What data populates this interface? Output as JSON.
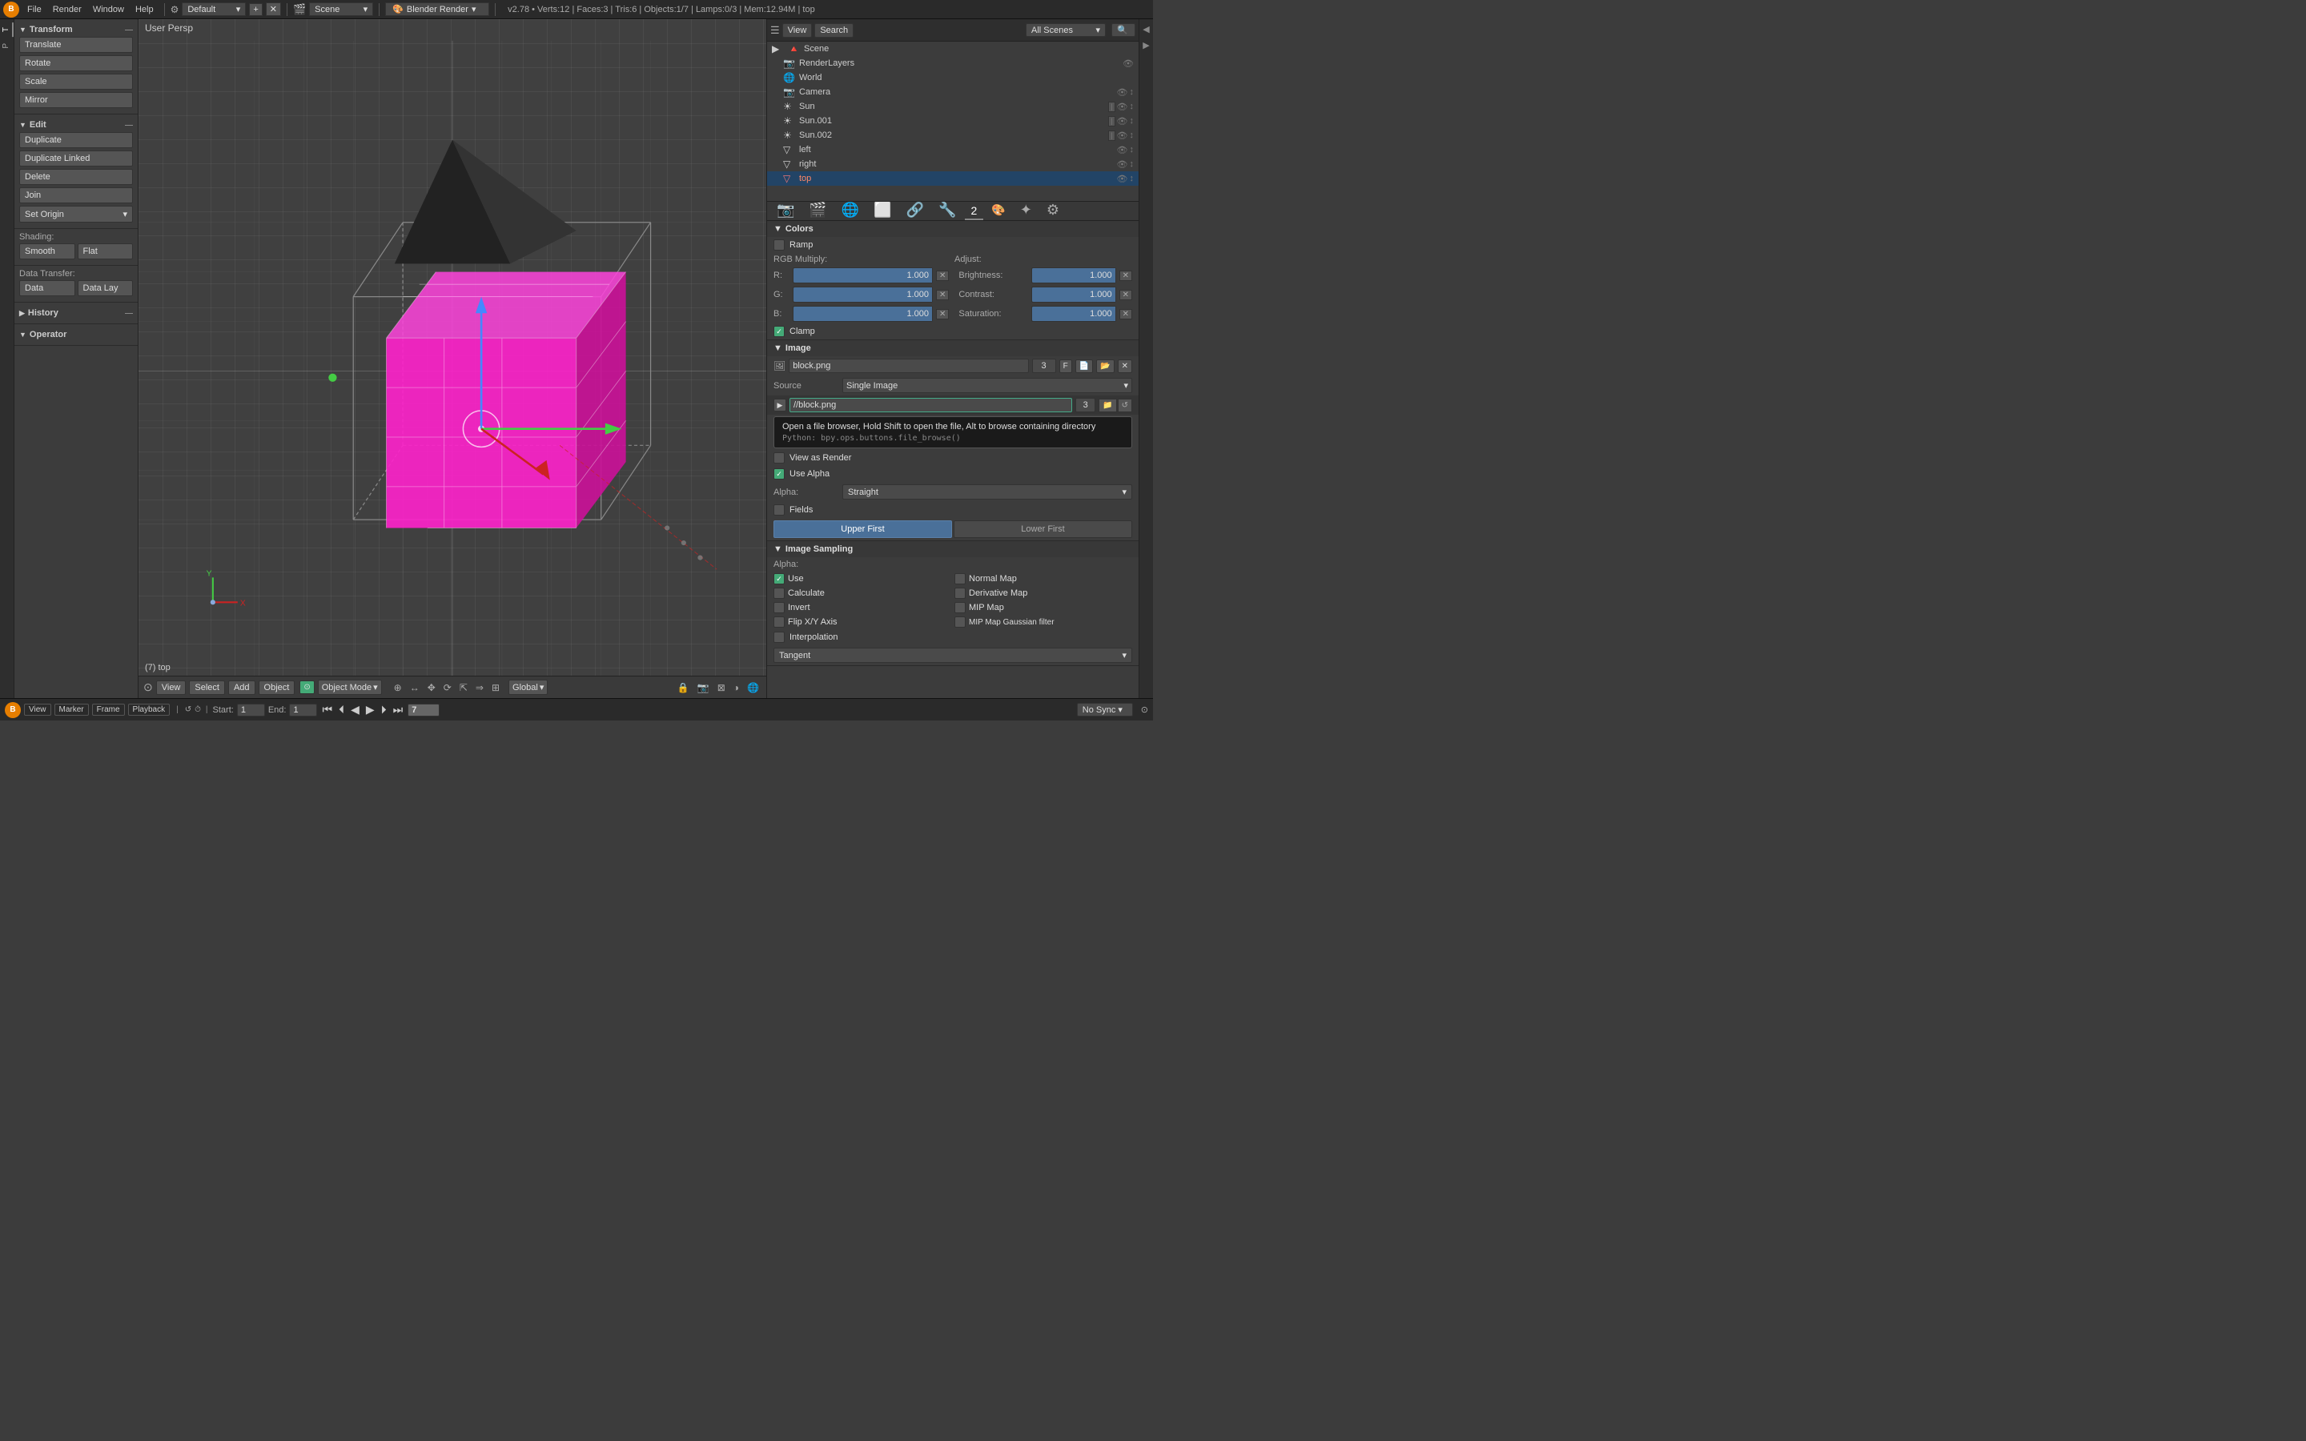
{
  "topbar": {
    "logo": "B",
    "menus": [
      "File",
      "Render",
      "Window",
      "Help"
    ],
    "workspace": "Default",
    "scene_label": "Scene",
    "engine": "Blender Render",
    "version_info": "v2.78 • Verts:12 | Faces:3 | Tris:6 | Objects:1/7 | Lamps:0/3 | Mem:12.94M | top"
  },
  "left_panel": {
    "transform_header": "Transform",
    "transform_buttons": [
      "Translate",
      "Rotate",
      "Scale",
      "Mirror"
    ],
    "edit_header": "Edit",
    "edit_buttons": [
      "Duplicate",
      "Duplicate Linked",
      "Delete",
      "Join"
    ],
    "set_origin_label": "Set Origin",
    "shading_label": "Shading:",
    "shading_btns": [
      "Smooth",
      "Flat"
    ],
    "data_transfer_label": "Data Transfer:",
    "data_transfer_btns": [
      "Data",
      "Data Lay"
    ],
    "history_header": "History",
    "operator_header": "Operator"
  },
  "viewport": {
    "title": "User Persp",
    "coord_label": "(7) top"
  },
  "viewport_bottom": {
    "icon": "⊙",
    "menus": [
      "View",
      "Select",
      "Add",
      "Object"
    ],
    "mode_label": "Object Mode",
    "global_label": "Global"
  },
  "outliner": {
    "view_label": "View",
    "search_label": "Search",
    "all_scenes_label": "All Scenes",
    "items": [
      {
        "level": 0,
        "icon": "🔺",
        "name": "Scene",
        "type": "scene"
      },
      {
        "level": 1,
        "icon": "📷",
        "name": "RenderLayers",
        "type": "renderlayers"
      },
      {
        "level": 1,
        "icon": "🌐",
        "name": "World",
        "type": "world"
      },
      {
        "level": 1,
        "icon": "📷",
        "name": "Camera",
        "type": "camera"
      },
      {
        "level": 1,
        "icon": "☀",
        "name": "Sun",
        "type": "light"
      },
      {
        "level": 1,
        "icon": "☀",
        "name": "Sun.001",
        "type": "light"
      },
      {
        "level": 1,
        "icon": "☀",
        "name": "Sun.002",
        "type": "light"
      },
      {
        "level": 1,
        "icon": "▽",
        "name": "left",
        "type": "mesh"
      },
      {
        "level": 1,
        "icon": "▽",
        "name": "right",
        "type": "mesh"
      },
      {
        "level": 1,
        "icon": "▽",
        "name": "top",
        "type": "mesh",
        "active": true
      }
    ]
  },
  "properties": {
    "colors_header": "Colors",
    "ramp_label": "Ramp",
    "rgb_multiply_label": "RGB Multiply:",
    "adjust_label": "Adjust:",
    "r_label": "R:",
    "r_value": "1.000",
    "g_label": "G:",
    "g_value": "1.000",
    "b_label": "B:",
    "b_value": "1.000",
    "brightness_label": "Brightness:",
    "brightness_value": "1.000",
    "contrast_label": "Contrast:",
    "contrast_value": "1.000",
    "saturation_label": "Saturation:",
    "saturation_value": "1.000",
    "clamp_label": "Clamp",
    "image_header": "Image",
    "filename": "block.png",
    "frame_num": "3",
    "frame_f": "F",
    "source_label": "Source",
    "source_value": "Single Image",
    "filepath": "//block.png",
    "filepath_num": "3",
    "tooltip_main": "Open a file browser, Hold Shift to open the file, Alt to browse containing directory",
    "tooltip_code": "Python: bpy.ops.buttons.file_browse()",
    "view_as_render_label": "View as Render",
    "use_alpha_label": "Use Alpha",
    "alpha_label": "Alpha:",
    "alpha_value": "Straight",
    "fields_label": "Fields",
    "upper_first_label": "Upper First",
    "lower_first_label": "Lower First",
    "image_sampling_header": "Image Sampling",
    "alpha_sampling_label": "Alpha:",
    "use_label": "Use",
    "calculate_label": "Calculate",
    "invert_label": "Invert",
    "flip_xy_label": "Flip X/Y Axis",
    "normal_map_label": "Normal Map",
    "derivative_map_label": "Derivative Map",
    "mip_map_label": "MIP Map",
    "mip_map_gaussian_label": "MIP Map Gaussian filter",
    "interpolation_label": "Interpolation",
    "tangent_label": "Tangent"
  },
  "timeline": {
    "icon": "B",
    "menus": [
      "View",
      "Marker",
      "Frame",
      "Playback"
    ],
    "start_label": "Start:",
    "start_value": "1",
    "end_label": "End:",
    "end_value": "1",
    "current_frame": "7",
    "sync_label": "No Sync"
  }
}
